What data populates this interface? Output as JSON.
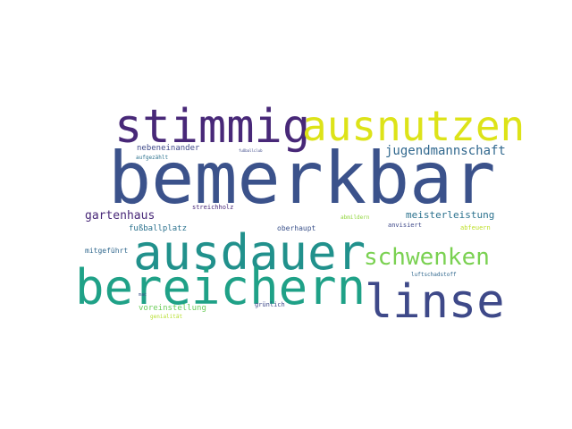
{
  "words": [
    {
      "text": "bemerkbar",
      "color": "#3b528b"
    },
    {
      "text": "stimmig",
      "color": "#482878"
    },
    {
      "text": "ausnutzen",
      "color": "#dde318"
    },
    {
      "text": "ausdauer",
      "color": "#21918c"
    },
    {
      "text": "bereichern",
      "color": "#1fa187"
    },
    {
      "text": "linse",
      "color": "#3e4989"
    },
    {
      "text": "schwenken",
      "color": "#7ad151"
    },
    {
      "text": "jugendmannschaft",
      "color": "#31688e"
    },
    {
      "text": "gartenhaus",
      "color": "#482878"
    },
    {
      "text": "meisterleistung",
      "color": "#2c728e"
    },
    {
      "text": "nebeneinander",
      "color": "#3e4989"
    },
    {
      "text": "fußballplatz",
      "color": "#2c728e"
    },
    {
      "text": "voreinstellung",
      "color": "#6ccd5a"
    },
    {
      "text": "oberhaupt",
      "color": "#3b528b"
    },
    {
      "text": "mitgeführt",
      "color": "#31688e"
    },
    {
      "text": "streichholz",
      "color": "#482878"
    },
    {
      "text": "anvisiert",
      "color": "#3e4989"
    },
    {
      "text": "abmildern",
      "color": "#93d741"
    },
    {
      "text": "abfeuern",
      "color": "#bddf26"
    },
    {
      "text": "luftschadstoff",
      "color": "#31688e"
    },
    {
      "text": "grünlich",
      "color": "#3e4989"
    },
    {
      "text": "aufgezählt",
      "color": "#2c728e"
    },
    {
      "text": "fußballclub",
      "color": "#3e4989"
    },
    {
      "text": "mac",
      "color": "#3b528b"
    },
    {
      "text": "genialität",
      "color": "#b5de2b"
    }
  ]
}
